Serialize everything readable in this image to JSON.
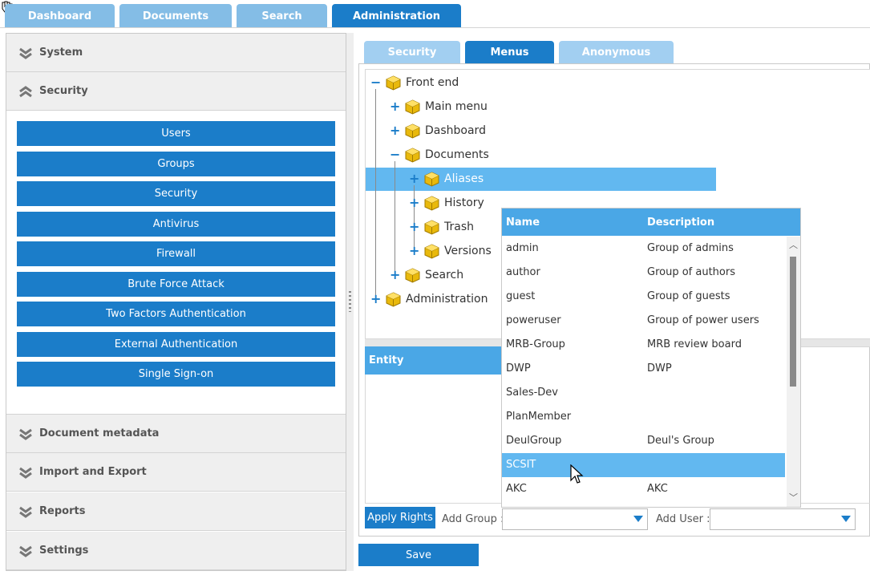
{
  "top_tabs": [
    "Dashboard",
    "Documents",
    "Search",
    "Administration"
  ],
  "sidebar": {
    "system": "System",
    "security": "Security",
    "security_buttons": [
      "Users",
      "Groups",
      "Security",
      "Antivirus",
      "Firewall",
      "Brute Force Attack",
      "Two Factors Authentication",
      "External Authentication",
      "Single Sign-on"
    ],
    "document_metadata": "Document metadata",
    "import_export": "Import and Export",
    "reports": "Reports",
    "settings": "Settings"
  },
  "sub_tabs": [
    "Security",
    "Menus",
    "Anonymous"
  ],
  "tree": {
    "front_end": "Front end",
    "main_menu": "Main menu",
    "dashboard": "Dashboard",
    "documents": "Documents",
    "aliases": "Aliases",
    "history": "History",
    "trash": "Trash",
    "versions": "Versions",
    "search": "Search",
    "administration": "Administration"
  },
  "entity_header": "Entity",
  "group_grid": {
    "col_name": "Name",
    "col_description": "Description",
    "rows": [
      {
        "name": "admin",
        "description": "Group of admins"
      },
      {
        "name": "author",
        "description": "Group of authors"
      },
      {
        "name": "guest",
        "description": "Group of guests"
      },
      {
        "name": "poweruser",
        "description": "Group of power users"
      },
      {
        "name": "MRB-Group",
        "description": "MRB review board"
      },
      {
        "name": "DWP",
        "description": "DWP"
      },
      {
        "name": "Sales-Dev",
        "description": ""
      },
      {
        "name": "PlanMember",
        "description": ""
      },
      {
        "name": "DeulGroup",
        "description": "Deul's Group"
      },
      {
        "name": "SCSIT",
        "description": ""
      },
      {
        "name": "AKC",
        "description": "AKC"
      }
    ]
  },
  "bottom": {
    "apply_rights": "Apply Rights",
    "add_group_label": "Add Group :",
    "add_user_label": "Add User :",
    "save": "Save"
  },
  "colors": {
    "primary": "#1b7dc9",
    "tab_inactive": "#84bde6",
    "selection": "#62b8f0",
    "grid_header": "#4aa7e6"
  }
}
